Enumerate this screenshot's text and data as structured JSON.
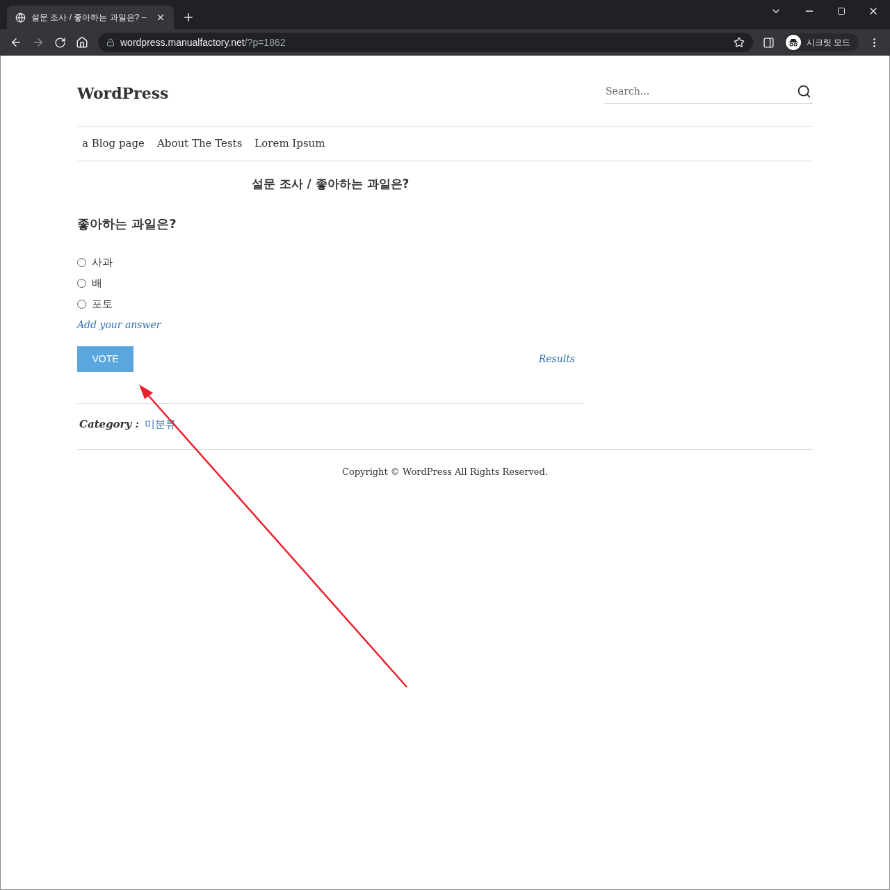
{
  "browser": {
    "tab": {
      "title": "설문 조사 / 좋아하는 과일은? –"
    },
    "url": {
      "host": "wordpress.manualfactory.net",
      "path": "/?p=1862"
    },
    "profile": "시크릿 모드"
  },
  "site": {
    "title": "WordPress",
    "search": {
      "placeholder": "Search..."
    },
    "menu": [
      "a Blog page",
      "About The Tests",
      "Lorem Ipsum"
    ]
  },
  "post": {
    "title": "설문 조사 / 좋아하는 과일은?",
    "poll": {
      "question": "좋아하는 과일은?",
      "options": [
        {
          "label": "사과",
          "selected": false
        },
        {
          "label": "배",
          "selected": false
        },
        {
          "label": "포토",
          "selected": false
        }
      ],
      "add_answer": "Add your answer",
      "vote": "VOTE",
      "results": "Results"
    },
    "category": {
      "label": "Category :",
      "value": "미분류"
    }
  },
  "footer": "Copyright © WordPress All Rights Reserved."
}
